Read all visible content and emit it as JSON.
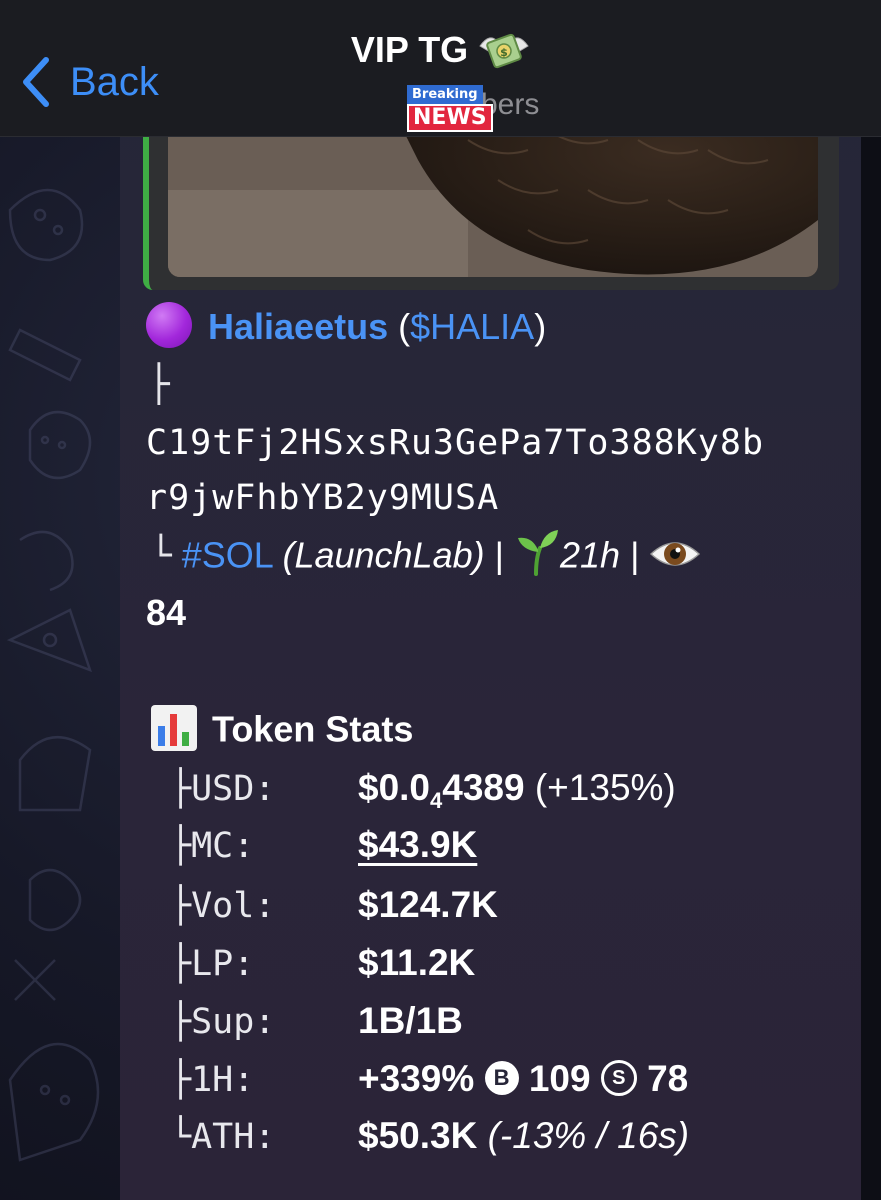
{
  "header": {
    "back_label": "Back",
    "title": "VIP TG",
    "title_icon": "money-with-wings-icon",
    "subtitle": "members",
    "subtitle_prefix_hidden": "1",
    "overlay_sticker_top": "Breaking",
    "overlay_sticker_bottom": "NEWS"
  },
  "message": {
    "token_icon": "purple-circle-icon",
    "token_name": "Haliaeetus",
    "paren_open": "(",
    "token_ticker": "$HALIA",
    "paren_close": ")",
    "tree_branch": "├",
    "address_line1": "C19tFj2HSxsRu3GePa7To388Ky8b",
    "address_line2": "r9jwFhbYB2y9MUSA",
    "tree_end": "└",
    "chain_tag": "#SOL",
    "launchpad": "(LaunchLab)",
    "separator": "|",
    "age_icon": "seedling-icon",
    "age": "21h",
    "views_icon": "eye-icon",
    "views": "84",
    "stats_icon": "bar-chart-icon",
    "stats_title": "Token Stats",
    "stats": [
      {
        "prefix": "├",
        "label": "USD:",
        "value_main": "$0.0",
        "value_sub": "4",
        "value_rest": "4389",
        "value_extra": "(+135%)"
      },
      {
        "prefix": "├",
        "label": "MC:",
        "value": "$43.9K"
      },
      {
        "prefix": "├",
        "label": "Vol:",
        "value": "$124.7K"
      },
      {
        "prefix": "├",
        "label": "LP:",
        "value": "$11.2K"
      },
      {
        "prefix": "├",
        "label": "Sup:",
        "value": "1B/1B"
      },
      {
        "prefix": "├",
        "label": "1H:",
        "value": "+339%",
        "buys_badge": "B",
        "buys": "109",
        "sells_badge": "S",
        "sells": "78"
      },
      {
        "prefix": "└",
        "label": "ATH:",
        "value": "$50.3K",
        "value_extra": "(-13% / 16s)"
      }
    ]
  },
  "colors": {
    "link": "#4a93f5",
    "header_bg": "#1b1c21",
    "bubble_bg": "#262538",
    "reply_bar": "#3fae44"
  }
}
